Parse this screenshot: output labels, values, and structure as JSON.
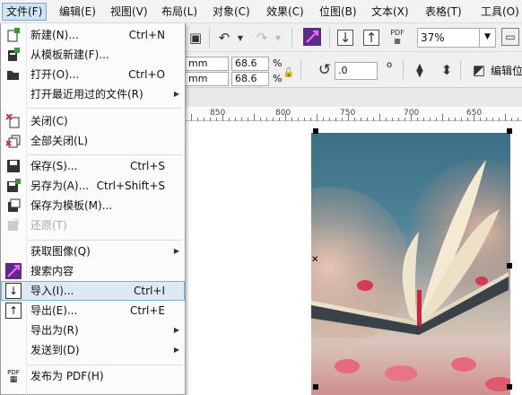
{
  "menubar": {
    "items": [
      {
        "label": "文件(F)",
        "active": true
      },
      {
        "label": "编辑(E)"
      },
      {
        "label": "视图(V)"
      },
      {
        "label": "布局(L)"
      },
      {
        "label": "对象(C)"
      },
      {
        "label": "效果(C)"
      },
      {
        "label": "位图(B)"
      },
      {
        "label": "文本(X)"
      },
      {
        "label": "表格(T)"
      },
      {
        "label": "工具(O)"
      }
    ]
  },
  "toolbar": {
    "zoom_value": "37%",
    "width_unit": "mm",
    "height_unit": "mm",
    "scale_x": "68.6",
    "scale_y": "68.6",
    "pct_x": "%",
    "pct_y": "%",
    "rotation": ".0",
    "rotation_unit": "o",
    "pdf_label": "PDF",
    "edit_label": "编辑位"
  },
  "ruler": {
    "labels": [
      "850",
      "800",
      "750",
      "700",
      "650"
    ]
  },
  "file_menu": {
    "items": [
      {
        "label": "新建(N)...",
        "shortcut": "Ctrl+N",
        "icon": "new-doc-icon"
      },
      {
        "label": "从模板新建(F)...",
        "shortcut": "",
        "icon": "template-icon"
      },
      {
        "label": "打开(O)...",
        "shortcut": "Ctrl+O",
        "icon": "folder-open-icon"
      },
      {
        "label": "打开最近用过的文件(R)",
        "shortcut": "",
        "submenu": true
      },
      {
        "label": "关闭(C)",
        "shortcut": "",
        "icon": "close-doc-icon"
      },
      {
        "label": "全部关闭(L)",
        "shortcut": "",
        "icon": "close-all-icon"
      },
      {
        "label": "保存(S)...",
        "shortcut": "Ctrl+S",
        "icon": "save-icon"
      },
      {
        "label": "另存为(A)...",
        "shortcut": "Ctrl+Shift+S",
        "icon": "save-as-icon"
      },
      {
        "label": "保存为模板(M)...",
        "shortcut": "",
        "icon": "save-template-icon"
      },
      {
        "label": "还原(T)",
        "shortcut": "",
        "icon": "revert-icon",
        "disabled": true
      },
      {
        "label": "获取图像(Q)",
        "shortcut": "",
        "submenu": true
      },
      {
        "label": "搜索内容",
        "shortcut": "",
        "icon": "search-content-icon"
      },
      {
        "label": "导入(I)...",
        "shortcut": "Ctrl+I",
        "icon": "import-icon",
        "highlight": true
      },
      {
        "label": "导出(E)...",
        "shortcut": "Ctrl+E",
        "icon": "export-icon"
      },
      {
        "label": "导出为(R)",
        "shortcut": "",
        "submenu": true
      },
      {
        "label": "发送到(D)",
        "shortcut": "",
        "submenu": true
      },
      {
        "label": "发布为 PDF(H)",
        "shortcut": "",
        "icon": "pdf-icon"
      }
    ],
    "pdf_icon_text": "PDF"
  },
  "colors": {
    "highlight": "#dceaf8",
    "highlight_border": "#7eaedb",
    "menubar_active": "#cfe3f7",
    "add_green": "#2e9e2e",
    "close_red": "#d03030",
    "purple": "#7a38a8"
  }
}
